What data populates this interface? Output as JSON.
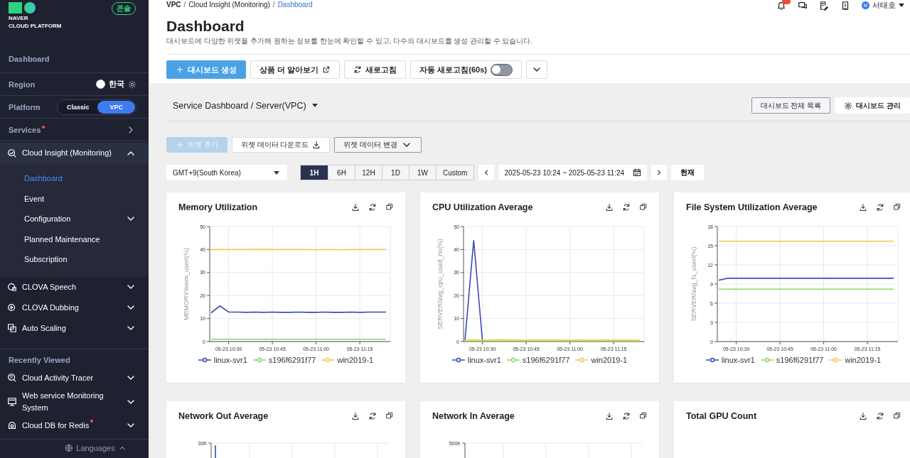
{
  "sidebar": {
    "brand": [
      "NAVER",
      "CLOUD PLATFORM"
    ],
    "console_badge": "콘솔",
    "home_link": "Dashboard",
    "region": {
      "label": "Region",
      "value": "한국"
    },
    "platform": {
      "label": "Platform",
      "options": [
        {
          "label": "Classic",
          "selected": false
        },
        {
          "label": "VPC",
          "selected": true
        }
      ]
    },
    "services": {
      "label": "Services",
      "new": true
    },
    "products": [
      {
        "label": "Cloud Insight (Monitoring)",
        "expanded": true,
        "children": [
          {
            "label": "Dashboard",
            "selected": true
          },
          {
            "label": "Event",
            "selected": false
          },
          {
            "label": "Configuration",
            "selected": false,
            "expanded": false
          },
          {
            "label": "Planned Maintenance",
            "selected": false
          },
          {
            "label": "Subscription",
            "selected": false
          }
        ]
      },
      {
        "label": "CLOVA Speech",
        "expanded": false
      },
      {
        "label": "CLOVA Dubbing",
        "expanded": false
      },
      {
        "label": "Auto Scaling",
        "expanded": false
      }
    ],
    "recent": {
      "title": "Recently Viewed",
      "items": [
        {
          "label": "Cloud Activity Tracer",
          "expanded": false,
          "new": false
        },
        {
          "label": "Web service Monitoring System",
          "expanded": false,
          "new": false
        },
        {
          "label": "Cloud DB for Redis",
          "expanded": false,
          "new": true
        }
      ]
    },
    "languages": "Languages"
  },
  "header": {
    "separator": "/",
    "breadcrumb": [
      {
        "label": "VPC",
        "current": false
      },
      {
        "label": "Cloud Insight (Monitoring)",
        "current": false
      },
      {
        "label": "Dashboard",
        "current": true
      }
    ],
    "avatar_initial": "M",
    "user": "서태호"
  },
  "page": {
    "title": "Dashboard",
    "description": "대시보드에 다양한 위젯을 추가해 원하는 정보를 한눈에 확인할 수 있고, 다수의 대시보드를 생성 관리할 수 있습니다."
  },
  "actions": [
    {
      "kind": "primary",
      "label": "대시보드 생성"
    },
    {
      "kind": "external",
      "label": "상품 더 알아보기"
    },
    {
      "kind": "refresh",
      "label": "새로고침"
    },
    {
      "kind": "toggle",
      "label": "자동 새로고침(60s)",
      "on": false
    },
    {
      "kind": "more"
    }
  ],
  "dashboard": {
    "selector": "Service Dashboard / Server(VPC)",
    "buttons": [
      {
        "kind": "outline",
        "label": "대시보드 전체 목록"
      },
      {
        "kind": "settings",
        "label": "대시보드 관리"
      }
    ]
  },
  "widget_actions": [
    {
      "kind": "add",
      "label": "위젯 추가",
      "disabled": true
    },
    {
      "kind": "download",
      "label": "위젯 데이터 다운로드",
      "disabled": false
    },
    {
      "kind": "dropdown",
      "label": "위젯 데이터 변경",
      "disabled": false
    }
  ],
  "time": {
    "timezone": "GMT+9(South Korea)",
    "ranges": [
      {
        "label": "1H",
        "selected": true
      },
      {
        "label": "6H",
        "selected": false
      },
      {
        "label": "12H",
        "selected": false
      },
      {
        "label": "1D",
        "selected": false
      },
      {
        "label": "1W",
        "selected": false
      },
      {
        "label": "Custom",
        "selected": false
      }
    ],
    "period": "2025-05-23 10:24 ~ 2025-05-23 11:24",
    "now_button": "현재"
  },
  "widgets": [
    {
      "kind": "line",
      "title": "Memory Utilization",
      "chart_data": {
        "type": "line",
        "grid": true,
        "legend": "bottom",
        "ylabel": "MEMORY/mem_usert(%)",
        "categories": [
          null,
          null,
          "05-23 10:30",
          null,
          null,
          null,
          null,
          "05-23 10:45",
          null,
          null,
          null,
          null,
          "05-23 11:00",
          null,
          null,
          null,
          null,
          "05-23 11:15",
          null,
          null,
          null
        ],
        "ylim": [
          0,
          50
        ],
        "yticks": [
          0,
          10,
          20,
          30,
          40,
          50
        ],
        "series": [
          {
            "name": "linux-svr1",
            "color": "#3b4bb5",
            "values": [
              12.5,
              15.5,
              12.8,
              12.8,
              12.7,
              12.8,
              12.7,
              12.8,
              12.7,
              12.7,
              12.8,
              12.7,
              12.7,
              12.8,
              12.7,
              12.7,
              12.8,
              12.7,
              12.8,
              12.8,
              12.8
            ]
          },
          {
            "name": "s196f6291f77",
            "color": "#8fd16a",
            "values": [
              1,
              1,
              1,
              1,
              1,
              1,
              1,
              1,
              1,
              1,
              1,
              1,
              1,
              1,
              1,
              1,
              1,
              1,
              1,
              1,
              1
            ]
          },
          {
            "name": "win2019-1",
            "color": "#f4c752",
            "values": [
              40,
              40,
              40,
              40,
              40,
              40,
              40.1,
              40,
              40,
              40,
              40,
              40,
              39.9,
              40,
              40,
              39.9,
              40,
              40,
              40,
              40,
              40
            ]
          }
        ]
      }
    },
    {
      "kind": "line",
      "title": "CPU Utilization Average",
      "chart_data": {
        "type": "line",
        "grid": true,
        "legend": "bottom",
        "ylabel": "SERVER/avg_cpu_used_rto(%)",
        "categories": [
          null,
          null,
          "05-23 10:30",
          null,
          null,
          null,
          null,
          "05-23 10:45",
          null,
          null,
          null,
          null,
          "05-23 11:00",
          null,
          null,
          null,
          null,
          "05-23 11:15",
          null,
          null,
          null
        ],
        "ylim": [
          0,
          50
        ],
        "yticks": [
          0,
          10,
          20,
          30,
          40,
          50
        ],
        "series": [
          {
            "name": "linux-svr1",
            "color": "#3b4bb5",
            "values": [
              0.5,
              44,
              0.3,
              null,
              null,
              null,
              null,
              null,
              null,
              null,
              null,
              null,
              null,
              null,
              null,
              null,
              null,
              null,
              null,
              null,
              null
            ]
          },
          {
            "name": "s196f6291f77",
            "color": "#8fd16a",
            "values": [
              0.2,
              0.2,
              0.2,
              0.2,
              0.2,
              0.2,
              0.2,
              0.2,
              0.2,
              0.2,
              0.2,
              0.2,
              0.2,
              0.2,
              0.2,
              0.2,
              0.2,
              0.2,
              0.2,
              0.2,
              0.2
            ]
          },
          {
            "name": "win2019-1",
            "color": "#f4c752",
            "values": [
              0.6,
              0.6,
              0.7,
              0.6,
              0.8,
              0.6,
              0.7,
              0.6,
              0.7,
              0.6,
              0.7,
              0.6,
              0.6,
              0.7,
              0.6,
              0.6,
              0.7,
              0.6,
              0.6,
              0.6,
              0.6
            ]
          }
        ]
      }
    },
    {
      "kind": "line",
      "title": "File System Utilization Average",
      "chart_data": {
        "type": "line",
        "grid": true,
        "legend": "bottom",
        "ylabel": "SERVER/avg_fs_usert(%)",
        "categories": [
          null,
          null,
          "05-23 10:30",
          null,
          null,
          null,
          null,
          "05-23 10:45",
          null,
          null,
          null,
          null,
          "05-23 11:00",
          null,
          null,
          null,
          null,
          "05-23 11:15",
          null,
          null,
          null
        ],
        "ylim": [
          0,
          18
        ],
        "yticks": [
          0,
          3,
          6,
          9,
          12,
          15,
          18
        ],
        "series": [
          {
            "name": "linux-svr1",
            "color": "#3b4bb5",
            "values": [
              9.6,
              9.9,
              9.9,
              9.9,
              9.9,
              9.9,
              9.9,
              9.9,
              9.9,
              9.9,
              9.9,
              9.9,
              9.9,
              9.9,
              9.9,
              9.9,
              9.9,
              9.9,
              9.9,
              9.9,
              9.9
            ]
          },
          {
            "name": "s196f6291f77",
            "color": "#8fd16a",
            "values": [
              8.2,
              8.2,
              8.2,
              8.2,
              8.2,
              8.2,
              8.2,
              8.2,
              8.2,
              8.2,
              8.2,
              8.2,
              8.2,
              8.2,
              8.2,
              8.2,
              8.2,
              8.2,
              8.2,
              8.2,
              8.2
            ]
          },
          {
            "name": "win2019-1",
            "color": "#f4c752",
            "values": [
              15.7,
              15.7,
              15.7,
              15.7,
              15.7,
              15.7,
              15.7,
              15.7,
              15.7,
              15.7,
              15.7,
              15.7,
              15.7,
              15.7,
              15.7,
              15.7,
              15.7,
              15.7,
              15.7,
              15.7,
              15.7
            ]
          }
        ]
      }
    },
    {
      "kind": "cut",
      "title": "Network Out Average",
      "top_tick": "30K",
      "spike": true
    },
    {
      "kind": "cut",
      "title": "Network In Average",
      "top_tick": "500K",
      "spike": false
    },
    {
      "kind": "empty",
      "title": "Total GPU Count"
    }
  ]
}
